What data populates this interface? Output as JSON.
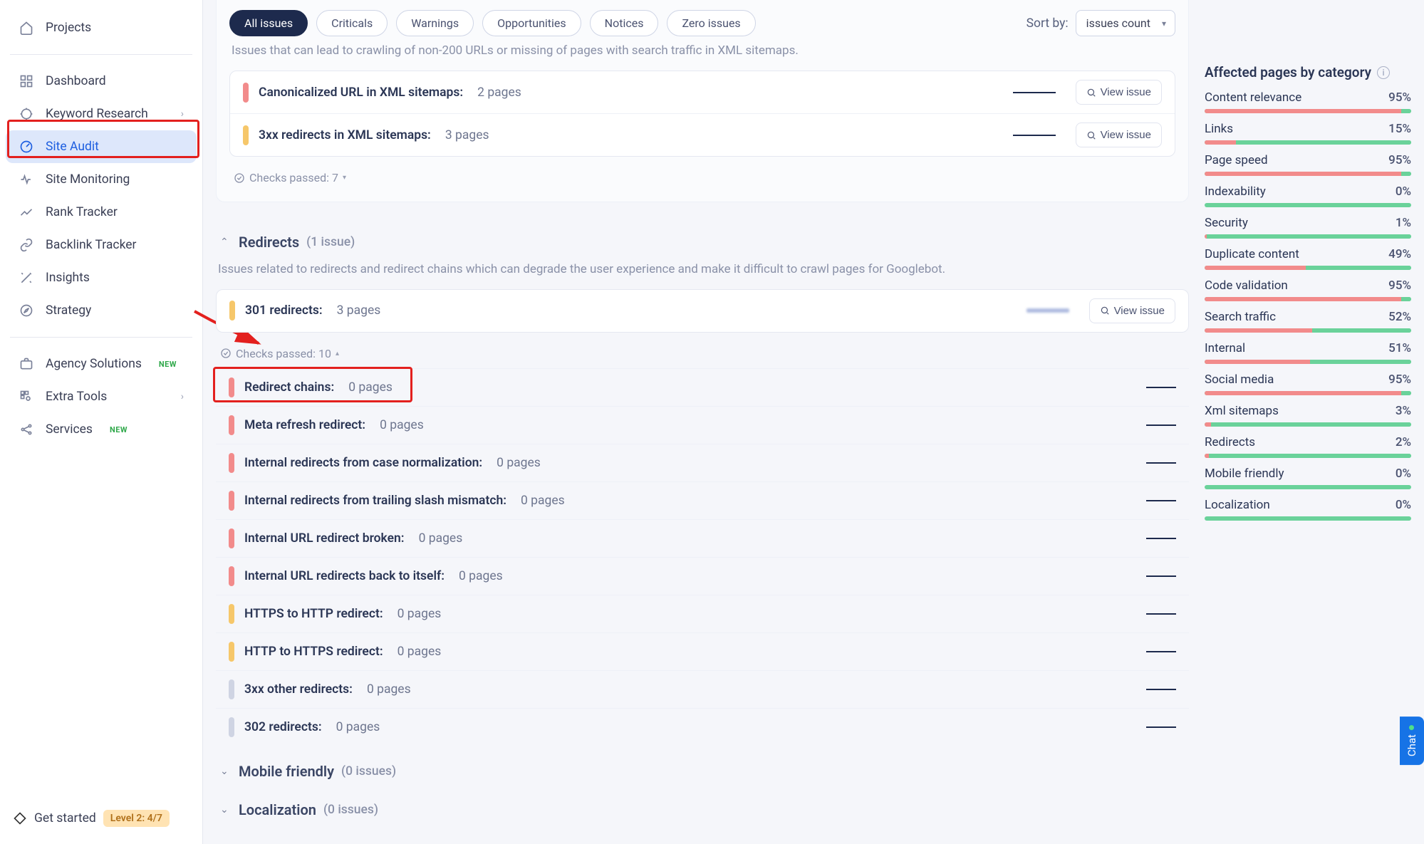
{
  "sidebar": {
    "items": [
      {
        "id": "projects",
        "label": "Projects",
        "icon": "home"
      },
      {
        "id": "dashboard",
        "label": "Dashboard",
        "icon": "grid"
      },
      {
        "id": "keyword-research",
        "label": "Keyword Research",
        "icon": "target",
        "hasCaret": true
      },
      {
        "id": "site-audit",
        "label": "Site Audit",
        "icon": "gauge",
        "active": true
      },
      {
        "id": "site-monitoring",
        "label": "Site Monitoring",
        "icon": "heartbeat"
      },
      {
        "id": "rank-tracker",
        "label": "Rank Tracker",
        "icon": "trend"
      },
      {
        "id": "backlink-tracker",
        "label": "Backlink Tracker",
        "icon": "link"
      },
      {
        "id": "insights",
        "label": "Insights",
        "icon": "wand"
      },
      {
        "id": "strategy",
        "label": "Strategy",
        "icon": "compass"
      },
      {
        "id": "agency-solutions",
        "label": "Agency Solutions",
        "icon": "briefcase",
        "tag": "NEW"
      },
      {
        "id": "extra-tools",
        "label": "Extra Tools",
        "icon": "apps",
        "hasCaret": true
      },
      {
        "id": "services",
        "label": "Services",
        "icon": "share",
        "tag": "NEW"
      }
    ],
    "get_started": "Get started",
    "level_badge": "Level 2: 4/7"
  },
  "filters": {
    "pills": [
      {
        "id": "all",
        "label": "All issues",
        "active": true
      },
      {
        "id": "criticals",
        "label": "Criticals"
      },
      {
        "id": "warnings",
        "label": "Warnings"
      },
      {
        "id": "opportunities",
        "label": "Opportunities"
      },
      {
        "id": "notices",
        "label": "Notices"
      },
      {
        "id": "zero",
        "label": "Zero issues"
      }
    ],
    "sort_label": "Sort by:",
    "sort_value": "issues count"
  },
  "sections": {
    "xml": {
      "desc": "Issues that can lead to crawling of non-200 URLs or missing of pages with search traffic in XML sitemaps.",
      "rows": [
        {
          "sev": "red",
          "label": "Canonicalized URL in XML sitemaps:",
          "count": "2 pages"
        },
        {
          "sev": "orange",
          "label": "3xx redirects in XML sitemaps:",
          "count": "3 pages"
        }
      ],
      "checks_passed": "Checks passed: 7"
    },
    "redirects": {
      "title": "Redirects",
      "title_count": "(1 issue)",
      "desc": "Issues related to redirects and redirect chains which can degrade the user experience and make it difficult to crawl pages for Googlebot.",
      "rows": [
        {
          "sev": "orange",
          "label": "301 redirects:",
          "count": "3 pages",
          "blurred": true
        }
      ],
      "checks_passed": "Checks passed: 10",
      "passed": [
        {
          "sev": "red",
          "label": "Redirect chains:",
          "count": "0 pages",
          "highlighted": true
        },
        {
          "sev": "red",
          "label": "Meta refresh redirect:",
          "count": "0 pages"
        },
        {
          "sev": "red",
          "label": "Internal redirects from case normalization:",
          "count": "0 pages"
        },
        {
          "sev": "red",
          "label": "Internal redirects from trailing slash mismatch:",
          "count": "0 pages"
        },
        {
          "sev": "red",
          "label": "Internal URL redirect broken:",
          "count": "0 pages"
        },
        {
          "sev": "red",
          "label": "Internal URL redirects back to itself:",
          "count": "0 pages"
        },
        {
          "sev": "orange",
          "label": "HTTPS to HTTP redirect:",
          "count": "0 pages"
        },
        {
          "sev": "orange",
          "label": "HTTP to HTTPS redirect:",
          "count": "0 pages"
        },
        {
          "sev": "gray",
          "label": "3xx other redirects:",
          "count": "0 pages"
        },
        {
          "sev": "gray",
          "label": "302 redirects:",
          "count": "0 pages"
        }
      ]
    },
    "mobile": {
      "title": "Mobile friendly",
      "title_count": "(0 issues)"
    },
    "localization": {
      "title": "Localization",
      "title_count": "(0 issues)"
    }
  },
  "labels": {
    "view_issue": "View issue"
  },
  "side_panel": {
    "title": "Affected pages by category",
    "categories": [
      {
        "name": "Content relevance",
        "pct": "95%",
        "bad": 95
      },
      {
        "name": "Links",
        "pct": "15%",
        "bad": 15
      },
      {
        "name": "Page speed",
        "pct": "95%",
        "bad": 95
      },
      {
        "name": "Indexability",
        "pct": "0%",
        "bad": 0
      },
      {
        "name": "Security",
        "pct": "1%",
        "bad": 1
      },
      {
        "name": "Duplicate content",
        "pct": "49%",
        "bad": 49
      },
      {
        "name": "Code validation",
        "pct": "95%",
        "bad": 95
      },
      {
        "name": "Search traffic",
        "pct": "52%",
        "bad": 52
      },
      {
        "name": "Internal",
        "pct": "51%",
        "bad": 51
      },
      {
        "name": "Social media",
        "pct": "95%",
        "bad": 95
      },
      {
        "name": "Xml sitemaps",
        "pct": "3%",
        "bad": 3
      },
      {
        "name": "Redirects",
        "pct": "2%",
        "bad": 2
      },
      {
        "name": "Mobile friendly",
        "pct": "0%",
        "bad": 0
      },
      {
        "name": "Localization",
        "pct": "0%",
        "bad": 0
      }
    ]
  },
  "chat": {
    "label": "Chat"
  }
}
